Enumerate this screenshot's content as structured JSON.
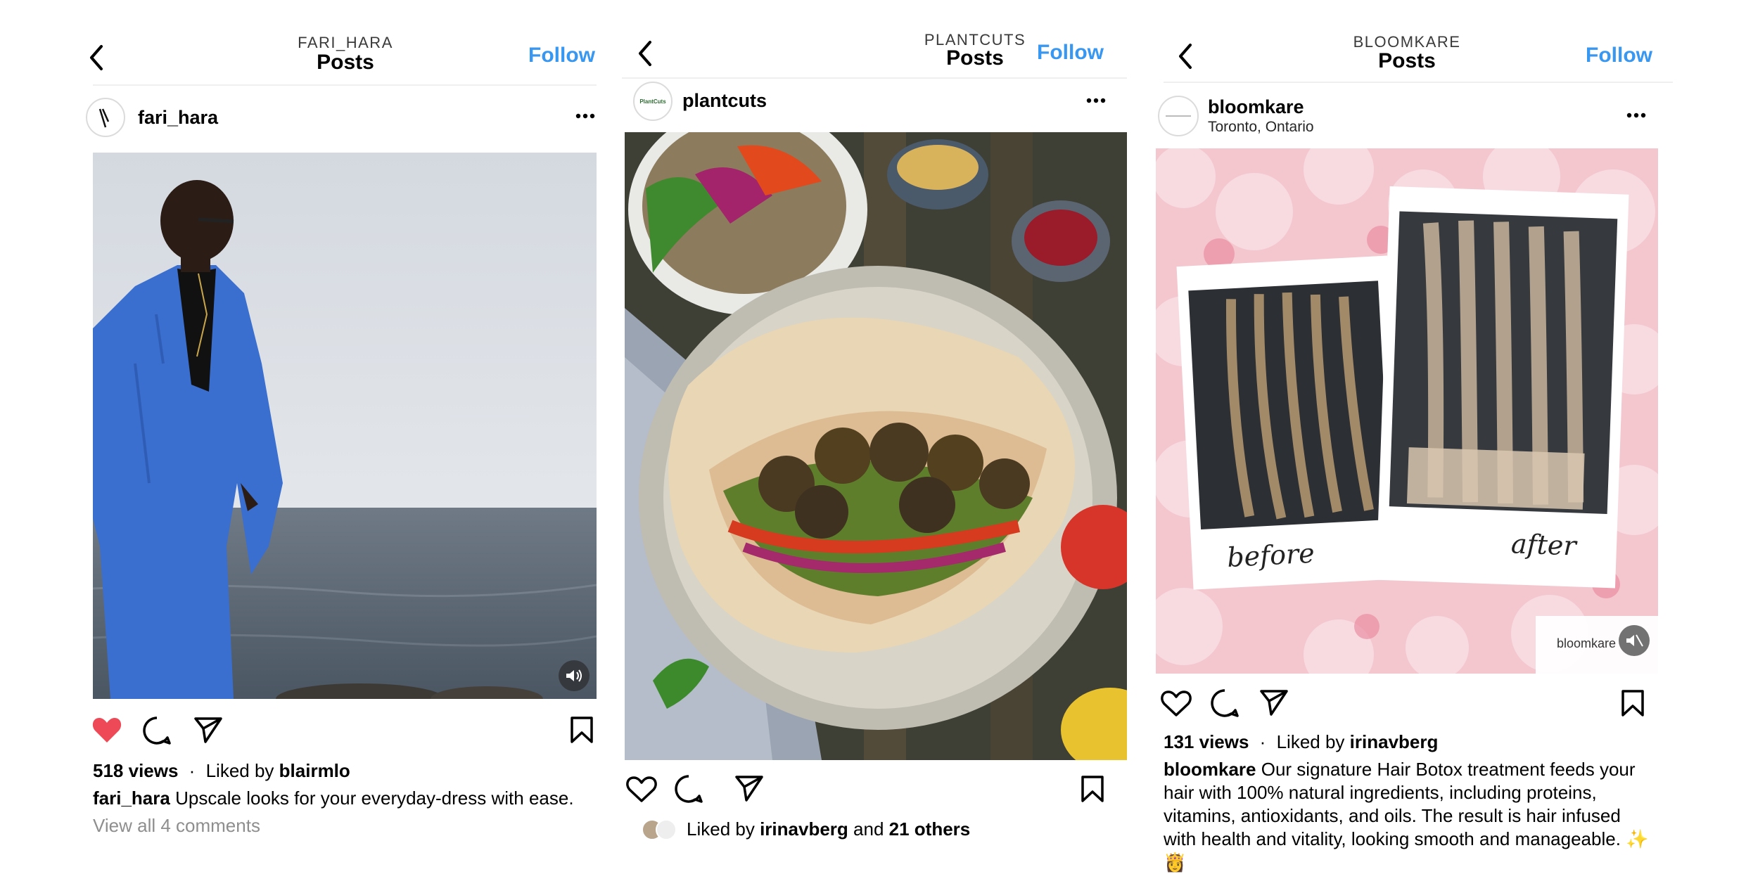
{
  "posts": [
    {
      "header_account": "FARI_HARA",
      "header_title": "Posts",
      "follow": "Follow",
      "username": "fari_hara",
      "views": "518 views",
      "dot": "·",
      "liked_prefix": "Liked by",
      "liked_user": "blairmlo",
      "caption_user": "fari_hara",
      "caption_text": "Upscale looks for your everyday-dress with ease.",
      "comments": "View all 4 comments",
      "liked": true
    },
    {
      "header_account": "PLANTCUTS",
      "header_title": "Posts",
      "follow": "Follow",
      "username": "plantcuts",
      "avatar_text": "PlantCuts",
      "liked_prefix": "Liked by",
      "liked_user": "irinavberg",
      "liked_and": "and",
      "liked_others": "21 others"
    },
    {
      "header_account": "BLOOMKARE",
      "header_title": "Posts",
      "follow": "Follow",
      "username": "bloomkare",
      "location": "Toronto, Ontario",
      "views": "131 views",
      "dot": "·",
      "liked_prefix": "Liked by",
      "liked_user": "irinavberg",
      "caption_user": "bloomkare",
      "caption_text": "Our signature Hair Botox treatment feeds your hair with 100% natural ingredients, including proteins, vitamins, antioxidants, and oils. The result is hair infused with health and vitality, looking smooth and manageable. ✨👸",
      "media_before": "before",
      "media_after": "after",
      "media_brand": "bloomkare"
    }
  ],
  "colors": {
    "follow": "#3897f0",
    "like": "#ed4956",
    "muted_text": "#8e8e8e"
  },
  "icons": [
    "chevron-left-icon",
    "more-horizontal-icon",
    "heart-icon",
    "comment-icon",
    "share-icon",
    "bookmark-icon",
    "volume-icon",
    "mute-icon"
  ]
}
